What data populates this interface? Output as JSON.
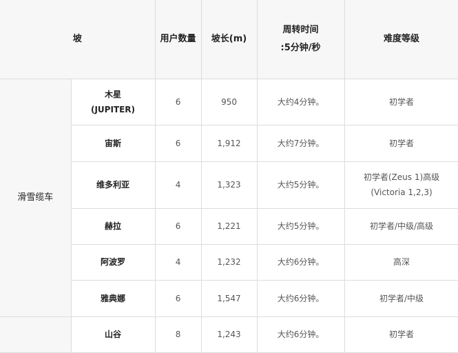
{
  "header": {
    "slope": "坡",
    "users": "用户数量",
    "length": "坡长(m)",
    "cycle_line1": "周转时间",
    "cycle_line2": ":5分钟/秒",
    "difficulty": "难度等级"
  },
  "groups": [
    {
      "label": "滑雪缆车"
    },
    {
      "label": ""
    }
  ],
  "rows": [
    {
      "name_line1": "木星",
      "name_line2": "(JUPITER)",
      "users": "6",
      "length": "950",
      "time": "大约4分钟。",
      "level_line1": "初学者",
      "level_line2": ""
    },
    {
      "name_line1": "宙斯",
      "name_line2": "",
      "users": "6",
      "length": "1,912",
      "time": "大约7分钟。",
      "level_line1": "初学者",
      "level_line2": ""
    },
    {
      "name_line1": "维多利亚",
      "name_line2": "",
      "users": "4",
      "length": "1,323",
      "time": "大约5分钟。",
      "level_line1": "初学者(Zeus 1)高级",
      "level_line2": "(Victoria 1,2,3)"
    },
    {
      "name_line1": "赫拉",
      "name_line2": "",
      "users": "6",
      "length": "1,221",
      "time": "大约5分钟。",
      "level_line1": "初学者/中级/高级",
      "level_line2": ""
    },
    {
      "name_line1": "阿波罗",
      "name_line2": "",
      "users": "4",
      "length": "1,232",
      "time": "大约6分钟。",
      "level_line1": "高深",
      "level_line2": ""
    },
    {
      "name_line1": "雅典娜",
      "name_line2": "",
      "users": "6",
      "length": "1,547",
      "time": "大约6分钟。",
      "level_line1": "初学者/中级",
      "level_line2": ""
    },
    {
      "name_line1": "山谷",
      "name_line2": "",
      "users": "8",
      "length": "1,243",
      "time": "大约6分钟。",
      "level_line1": "初学者",
      "level_line2": ""
    }
  ]
}
